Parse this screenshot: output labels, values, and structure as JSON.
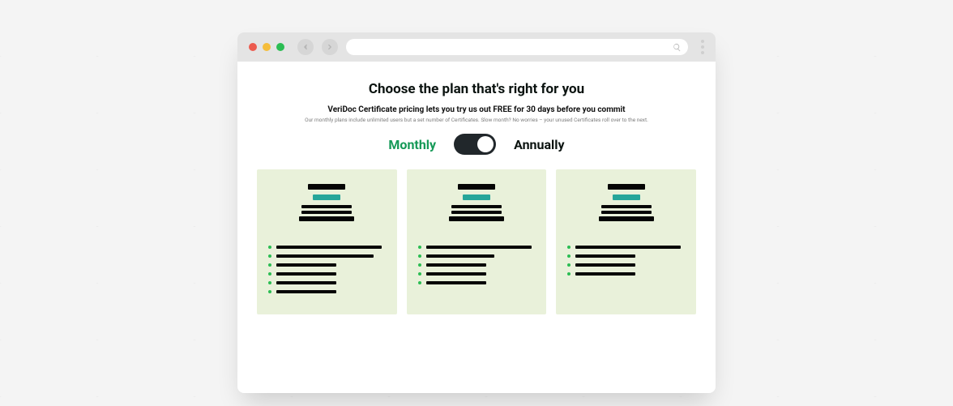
{
  "header": {
    "title": "Choose the plan that's right for you",
    "subtitle": "VeriDoc Certificate pricing lets you try us out FREE for 30 days before you commit",
    "subtext": "Our monthly plans include unlimited users but a set number of Certificates. Slow month? No worries – your unused Certificates roll over to the next."
  },
  "billing": {
    "monthly_label": "Monthly",
    "annually_label": "Annually",
    "active": "monthly"
  },
  "feature_row_widths": {
    "card1": [
      130,
      120,
      74,
      74,
      74,
      74
    ],
    "card2": [
      130,
      84,
      74,
      74,
      74
    ],
    "card3": [
      130,
      74,
      74,
      74
    ]
  },
  "colors": {
    "accent_green": "#159957",
    "accent_teal": "#26a69a",
    "card_bg": "#e9f1da"
  }
}
